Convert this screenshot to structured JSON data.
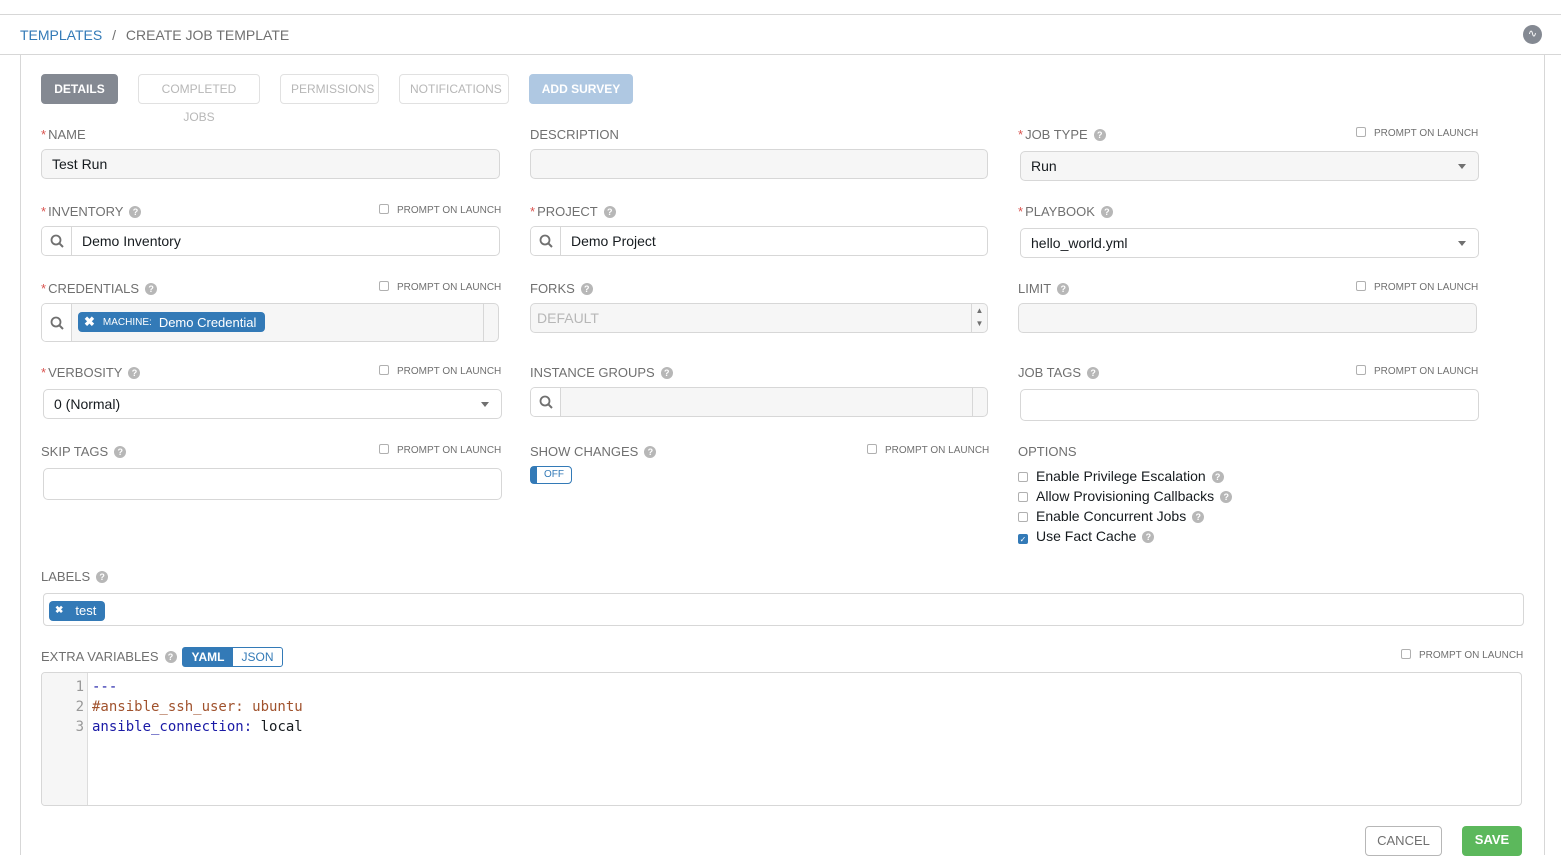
{
  "breadcrumb": {
    "parent": "TEMPLATES",
    "separator": "/",
    "current": "CREATE JOB TEMPLATE"
  },
  "tabs": [
    {
      "label": "DETAILS",
      "active": true
    },
    {
      "label": "COMPLETED JOBS"
    },
    {
      "label": "PERMISSIONS"
    },
    {
      "label": "NOTIFICATIONS"
    },
    {
      "label": "ADD SURVEY"
    }
  ],
  "prompt_on_launch": "PROMPT ON LAUNCH",
  "help": "?",
  "fields": {
    "name": {
      "label": "NAME",
      "value": "Test Run",
      "required": true
    },
    "description": {
      "label": "DESCRIPTION",
      "value": ""
    },
    "job_type": {
      "label": "JOB TYPE",
      "value": "Run",
      "required": true
    },
    "inventory": {
      "label": "INVENTORY",
      "value": "Demo Inventory",
      "required": true
    },
    "project": {
      "label": "PROJECT",
      "value": "Demo Project",
      "required": true
    },
    "playbook": {
      "label": "PLAYBOOK",
      "value": "hello_world.yml",
      "required": true
    },
    "credentials": {
      "label": "CREDENTIALS",
      "required": true,
      "chip_kind": "MACHINE:",
      "chip_value": "Demo Credential"
    },
    "forks": {
      "label": "FORKS",
      "placeholder": "DEFAULT"
    },
    "limit": {
      "label": "LIMIT",
      "value": ""
    },
    "verbosity": {
      "label": "VERBOSITY",
      "value": "0 (Normal)",
      "required": true
    },
    "instance_groups": {
      "label": "INSTANCE GROUPS"
    },
    "job_tags": {
      "label": "JOB TAGS",
      "value": ""
    },
    "skip_tags": {
      "label": "SKIP TAGS",
      "value": ""
    },
    "show_changes": {
      "label": "SHOW CHANGES",
      "toggle": "OFF"
    },
    "options": {
      "label": "OPTIONS",
      "items": [
        {
          "label": "Enable Privilege Escalation",
          "checked": false
        },
        {
          "label": "Allow Provisioning Callbacks",
          "checked": false
        },
        {
          "label": "Enable Concurrent Jobs",
          "checked": false
        },
        {
          "label": "Use Fact Cache",
          "checked": true
        }
      ]
    },
    "labels": {
      "label": "LABELS",
      "chips": [
        "test"
      ]
    },
    "extra_variables": {
      "label": "EXTRA VARIABLES",
      "modes": [
        "YAML",
        "JSON"
      ],
      "active_mode": "YAML",
      "lines": [
        {
          "n": "1",
          "text": "---"
        },
        {
          "n": "2",
          "text": "#ansible_ssh_user: ubuntu"
        },
        {
          "n": "3",
          "key": "ansible_connection:",
          "value": " local"
        }
      ]
    }
  },
  "actions": {
    "cancel": "CANCEL",
    "save": "SAVE"
  },
  "colors": {
    "primary": "#337ab7",
    "save": "#5cb85c",
    "required": "#d9534f"
  }
}
